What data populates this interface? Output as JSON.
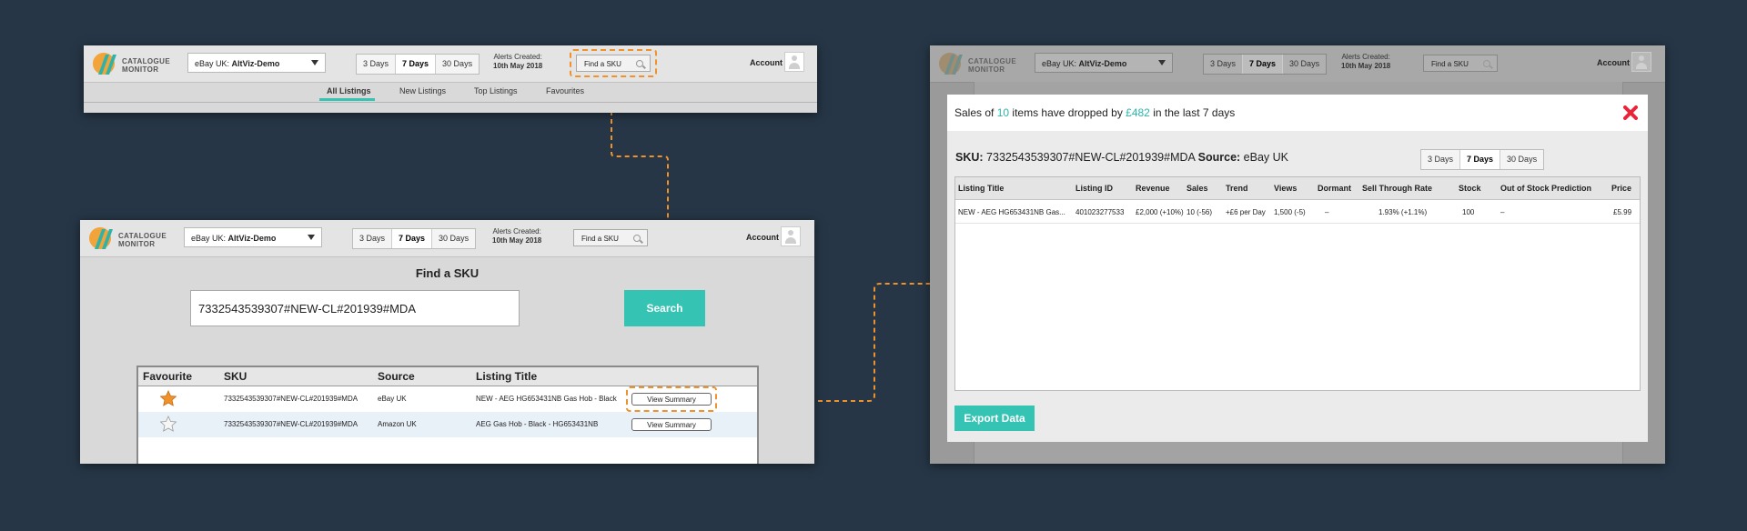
{
  "brand": {
    "logo_line1": "CATALOGUE",
    "logo_line2": "MONITOR"
  },
  "header": {
    "account_prefix": "eBay UK:",
    "account_name": "AltViz-Demo",
    "day_options": [
      "3 Days",
      "7 Days",
      "30 Days"
    ],
    "active_day": "7 Days",
    "alerts_label": "Alerts Created:",
    "alerts_date": "10th May 2018",
    "find_sku_label": "Find a SKU",
    "account_label": "Account"
  },
  "subnav": {
    "items": [
      "All Listings",
      "New Listings",
      "Top Listings",
      "Favourites"
    ],
    "active": "All Listings"
  },
  "find_sku_page": {
    "title": "Find a SKU",
    "search_value": "7332543539307#NEW-CL#201939#MDA",
    "search_button": "Search",
    "table_headers": [
      "Favourite",
      "SKU",
      "Source",
      "Listing Title"
    ],
    "rows": [
      {
        "favourite": true,
        "sku": "7332543539307#NEW-CL#201939#MDA",
        "source": "eBay UK",
        "title": "NEW - AEG HG653431NB Gas Hob - Black",
        "action": "View Summary"
      },
      {
        "favourite": false,
        "sku": "7332543539307#NEW-CL#201939#MDA",
        "source": "Amazon UK",
        "title": "AEG Gas Hob - Black - HG653431NB",
        "action": "View Summary"
      }
    ]
  },
  "modal": {
    "alert_prefix": "Sales of",
    "alert_count": "10",
    "alert_mid": "items have dropped by",
    "alert_amount": "£482",
    "alert_suffix": "in the last 7 days",
    "sku_label": "SKU:",
    "sku_value": "7332543539307#NEW-CL#201939#MDA",
    "source_label": "Source:",
    "source_value": "eBay UK",
    "table_headers": [
      "Listing Title",
      "Listing ID",
      "Revenue",
      "Sales",
      "Trend",
      "Views",
      "Dormant",
      "Sell Through Rate",
      "Stock",
      "Out of Stock Prediction",
      "Price"
    ],
    "row": [
      "NEW - AEG HG653431NB Gas...",
      "401023277533",
      "£2,000 (+10%)",
      "10 (-56)",
      "+£6 per Day",
      "1,500 (-5)",
      "–",
      "1.93% (+1.1%)",
      "100",
      "–",
      "£5.99"
    ],
    "export_button": "Export Data"
  },
  "colors": {
    "accent": "#35c4b4",
    "highlight": "#f0922b",
    "close": "#e8253a",
    "background": "#263646"
  }
}
